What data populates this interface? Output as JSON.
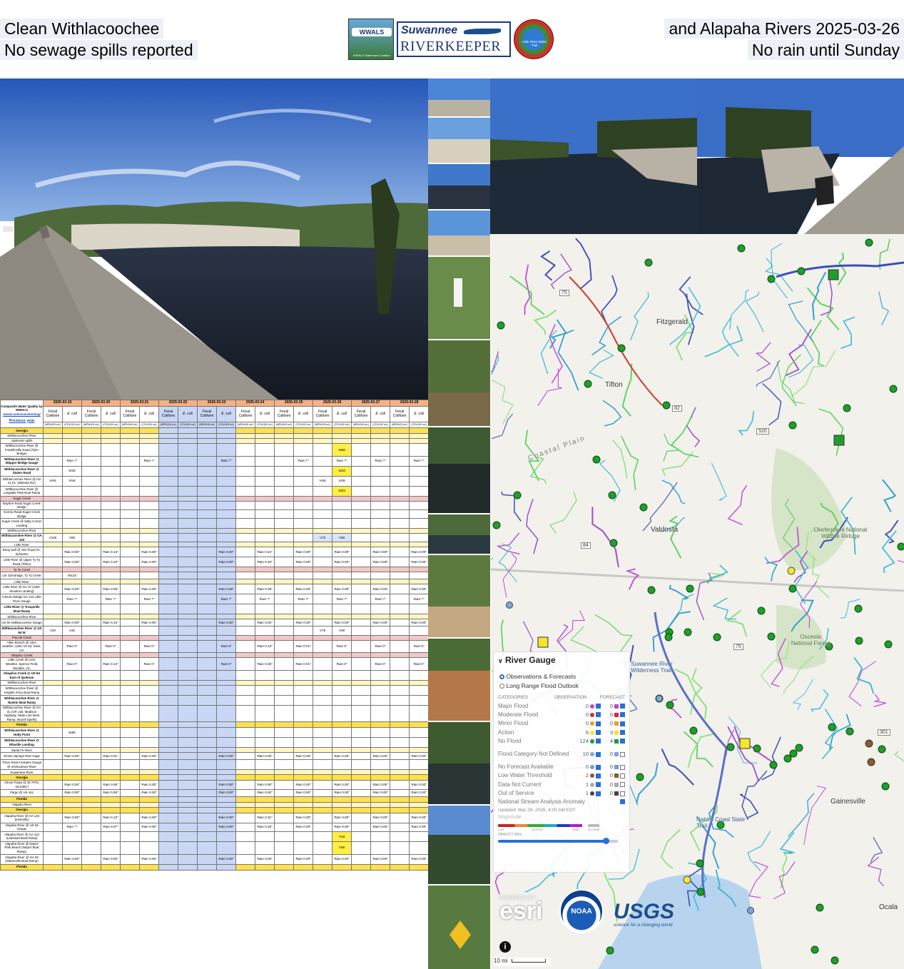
{
  "captions": {
    "top_left_1": "Clean Withlacoochee",
    "top_left_2": "No sewage spills reported",
    "top_right_1": "and Alapaha Rivers 2025-03-26",
    "top_right_2": "No rain until Sunday"
  },
  "logos": {
    "wwals": "WWALS Watershed Coalition",
    "riverkeeper_1": "Suwannee",
    "riverkeeper_2": "RIVERKEEPER",
    "little_river": "Little River Water Trail"
  },
  "table": {
    "corner": "Composite Water Quality by WWALS",
    "corner_link": "wwals.net/issues/testing/",
    "previous_year": "Previous year",
    "dates": [
      "2025-03-19",
      "2025-03-20",
      "2025-03-21",
      "2025-03-22",
      "2025-03-23",
      "2025-03-24",
      "2025-03-25",
      "2025-03-26",
      "2025-03-27",
      "2025-03-28"
    ],
    "col_fecal": "Fecal Coliform",
    "col_ecoli": "E. coli",
    "unit_fecal": "(MPN/100 mL)",
    "unit_ecoli": "(CFU/100 mL)",
    "rows": [
      {
        "t": "y",
        "label": "Georgia"
      },
      {
        "t": "s",
        "label": "Withlacoochee River"
      },
      {
        "t": "s",
        "label": "Upstream spills"
      },
      {
        "label": "Withlacoochee River @ Franklinville Road (Tyler Bridge)",
        "c": {
          "15": "W66"
        },
        "hl": [
          "15"
        ]
      },
      {
        "label": "Withlacoochee River @ Skipper Bridge Gauge",
        "c": {
          "1": "Rain ?\"",
          "5": "Rain ?\"",
          "9": "Rain ?\"",
          "13": "Rain ?\"",
          "15": "Rain ?\"",
          "17": "Rain ?\"",
          "19": "Rain ?\""
        }
      },
      {
        "label": "Withlacoochee River @ Staten Road",
        "c": {
          "1": "W33",
          "15": "W33"
        },
        "hl": [
          "15"
        ]
      },
      {
        "label": "Withlacoochee River @ US 41 (N. Valdosta Rd.)",
        "c": {
          "0": "VNS",
          "1": "VNS",
          "14": "VNS",
          "15": "VNS"
        }
      },
      {
        "label": "Withlacoochee River @ Langdale Park Boat Ramp",
        "c": {
          "15": "W33"
        },
        "hl": [
          "15"
        ]
      },
      {
        "t": "p",
        "label": "Sugar Creek"
      },
      {
        "label": "Baytree Road Sugar Creek Bridge",
        "c": {}
      },
      {
        "label": "Gornto Road Sugar Creek Bridge",
        "c": {}
      },
      {
        "label": "Sugar Creek @ Salty Corner Landing",
        "c": {}
      },
      {
        "t": "s",
        "label": "Withlacoochee River"
      },
      {
        "label": "Withlacoochee River @ GA 133",
        "c": {
          "0": "V160",
          "1": "V80",
          "14": "V70",
          "15": "V90"
        },
        "lb": [
          "14",
          "15"
        ]
      },
      {
        "t": "s",
        "label": "Little River"
      },
      {
        "label": "Deep well @ 161 Royal St., Sylvester",
        "c": {
          "1": "Rain 0.00\"",
          "3": "Rain 0.13\"",
          "5": "Rain 0.00\"",
          "9": "Rain 0.00\"",
          "11": "Rain 0.44\"",
          "13": "Rain 0.00\"",
          "15": "Rain 0.00\"",
          "17": "Rain 0.00\"",
          "19": "Rain 0.00\""
        }
      },
      {
        "label": "Little River @ Upper Ty Ty Road (Tifton)",
        "c": {
          "1": "Rain 0.00\"",
          "3": "Rain 0.10\"",
          "5": "Rain 0.00\"",
          "9": "Rain 0.00\"",
          "11": "Rain 0.33\"",
          "13": "Rain 0.00\"",
          "15": "Rain 0.00\"",
          "17": "Rain 0.00\"",
          "19": "Rain 0.00\""
        }
      },
      {
        "t": "p",
        "label": "Ty Ty Creek"
      },
      {
        "label": "US 319 Bridge, Ty Ty Creek",
        "c": {
          "1": "W133"
        }
      },
      {
        "t": "s",
        "label": "Little River"
      },
      {
        "label": "Little River @ GA 37 (Adel-Moultrie Landing)",
        "c": {
          "1": "Rain 0.00\"",
          "3": "Rain 0.08\"",
          "5": "Rain 0.00\"",
          "9": "Rain 0.00\"",
          "11": "Rain 0.28\"",
          "13": "Rain 0.00\"",
          "15": "Rain 0.00\"",
          "17": "Rain 0.00\"",
          "19": "Rain 0.00\""
        }
      },
      {
        "label": "Folsom Bridge GA 122 Little River Gauge",
        "c": {
          "1": "Rain ?\"",
          "3": "Rain ?\"",
          "5": "Rain ?\"",
          "9": "Rain ?\"",
          "11": "Rain ?\"",
          "13": "Rain ?\"",
          "15": "Rain ?\"",
          "17": "Rain ?\"",
          "19": "Rain ?\""
        }
      },
      {
        "label": "Little River @ Troupville Boat Ramp",
        "c": {}
      },
      {
        "t": "s",
        "label": "Withlacoochee River"
      },
      {
        "label": "US 84 Withlacoochee Gauge",
        "c": {
          "1": "Rain 0.00\"",
          "3": "Rain 0.10\"",
          "5": "Rain 0.00\"",
          "9": "Rain 0.00\"",
          "11": "Rain 0.02\"",
          "13": "Rain 0.00\"",
          "15": "Rain 0.00\"",
          "17": "Rain 0.00\"",
          "19": "Rain 0.00\""
        }
      },
      {
        "label": "Withlacoochee River @ US 84 W",
        "c": {
          "0": "V20",
          "1": "V40",
          "14": "V75",
          "15": "V90"
        }
      },
      {
        "t": "p",
        "label": "Piscola Creek"
      },
      {
        "label": "Allen Branch @ UGA weather, 4281 US 84, Dixie, GA",
        "c": {
          "1": "Rain 0\"",
          "3": "Rain 0\"",
          "5": "Rain 0\"",
          "9": "Rain 0\"",
          "11": "Rain 0.13\"",
          "13": "Rain 0.01\"",
          "15": "Rain 0\"",
          "17": "Rain 0\"",
          "19": "Rain 0\""
        }
      },
      {
        "t": "p",
        "label": "Okapilco Creek"
      },
      {
        "label": "Little Creek @ UGA Weather, Spence Field, Moultrie, GA",
        "c": {
          "1": "Rain 0\"",
          "3": "Rain 0.13\"",
          "5": "Rain 0\"",
          "9": "Rain 0\"",
          "11": "Rain 0.35\"",
          "13": "Rain 0.01\"",
          "15": "Rain 0\"",
          "17": "Rain 0\"",
          "19": "Rain 0\""
        }
      },
      {
        "label": "Okapilco Creek @ US 84 East of Quitman",
        "c": {}
      },
      {
        "t": "s",
        "label": "Withlacoochee River"
      },
      {
        "label": "Withlacoochee River @ Knights Ferry Boat Ramp",
        "c": {}
      },
      {
        "label": "Withlacoochee River @ Nankin Boat Ramp",
        "c": {}
      },
      {
        "label": "Withlacoochee River @ GA 31 (CR 145, Madison Highway, State Line Boat Ramp, Mozell Spells)",
        "c": {}
      },
      {
        "t": "y",
        "label": "Florida"
      },
      {
        "label": "Withlacoochee River @ Holly Point",
        "c": {
          "1": "W66"
        }
      },
      {
        "label": "Withlacoochee River @ Ellaville Landing",
        "c": {}
      },
      {
        "t": "s",
        "label": "Santa Fe River"
      },
      {
        "label": "Ginnie Springs Rain Gage",
        "c": {
          "1": "Rain 0.00\"",
          "3": "Rain 0.01\"",
          "5": "Rain 0.00\"",
          "9": "Rain 0.00\"",
          "11": "Rain 0.00\"",
          "13": "Rain 0.00\"",
          "15": "Rain 0.00\"",
          "17": "Rain 0.00\"",
          "19": "Rain 0.00\""
        }
      },
      {
        "label": "Three Rivers Estates Gauge @ Ichetucknee River",
        "c": {}
      },
      {
        "t": "s",
        "label": "Suwannee River"
      },
      {
        "t": "y",
        "label": "Georgia"
      },
      {
        "label": "Above Fargo @ 30.7075, -82.53917",
        "c": {
          "1": "Rain 0.00\"",
          "3": "Rain 0.06\"",
          "5": "Rain 0.00\"",
          "9": "Rain 0.00\"",
          "11": "Rain 0.00\"",
          "13": "Rain 0.00\"",
          "15": "Rain 0.00\"",
          "17": "Rain 0.00\"",
          "19": "Rain 0.00\""
        }
      },
      {
        "label": "Fargo @ US 441",
        "c": {
          "1": "Rain 0.00\"",
          "3": "Rain 0.08\"",
          "5": "Rain 0.00\"",
          "9": "Rain 0.00\"",
          "11": "Rain 0.00\"",
          "13": "Rain 0.00\"",
          "15": "Rain 0.00\"",
          "17": "Rain 0.00\"",
          "19": "Rain 0.00\""
        }
      },
      {
        "t": "y",
        "label": "Florida"
      },
      {
        "t": "s",
        "label": "Alapaha River"
      },
      {
        "t": "y",
        "label": "Georgia"
      },
      {
        "label": "Alapaha River @ GA 125 (Irwinville)",
        "c": {
          "1": "Rain 0.00\"",
          "3": "Rain 0.13\"",
          "5": "Rain 0.00\"",
          "9": "Rain 0.00\"",
          "11": "Rain 0.31\"",
          "13": "Rain 0.00\"",
          "15": "Rain 0.00\"",
          "17": "Rain 0.00\"",
          "19": "Rain 0.00\""
        }
      },
      {
        "label": "Alapaha River @ US 82 Gauge",
        "c": {
          "1": "Rain ?\"",
          "3": "Rain 0.07\"",
          "5": "Rain 0.00\"",
          "9": "Rain 0.00\"",
          "11": "Rain 0.25\"",
          "13": "Rain 0.00\"",
          "15": "Rain 0.00\"",
          "17": "Rain 0.00\"",
          "19": "Rain 0.00\""
        }
      },
      {
        "label": "Alapaha River @ GA 122 (Lakeland Boat Ramp)",
        "c": {
          "15": "V33"
        },
        "hl": [
          "15"
        ]
      },
      {
        "label": "Alapaha River @ Naylor Park Beach (Naylor Boat Ramp)",
        "c": {
          "15": "V66"
        },
        "hl": [
          "15"
        ]
      },
      {
        "label": "Alapaha River @ GA 94 (Statenville Boat Ramp)",
        "c": {
          "1": "Rain 0.00\"",
          "3": "Rain 0.05\"",
          "5": "Rain 0.00\"",
          "9": "Rain 0.00\"",
          "11": "Rain 0.00\"",
          "13": "Rain 0.00\"",
          "15": "Rain 0.00\"",
          "17": "Rain 0.00\"",
          "19": "Rain 0.00\""
        }
      },
      {
        "t": "y",
        "label": "Florida"
      }
    ]
  },
  "map": {
    "places": {
      "fitzgerald": "Fitzgerald",
      "tifton": "Tifton",
      "valdosta": "Valdosta",
      "okefenokee": "Okefenokee National Wildlife Refuge",
      "osceola": "Osceola National Forest",
      "suwannee_trail": "Suwannee River Wilderness Trail",
      "nature_coast": "Nature Coast State Trail",
      "gainesville": "Gainesville",
      "ocala": "Ocala",
      "coastal_plain": "Coastal Plain"
    },
    "routes": [
      "75",
      "82",
      "520",
      "84",
      "75",
      "301"
    ],
    "scale": "10 mi",
    "legend": {
      "title": "River Gauge",
      "opt1": "Observations & Forecasts",
      "opt2": "Long Range Flood Outlook",
      "h_categories": "CATEGORIES",
      "h_observation": "OBSERVATION",
      "h_forecast": "FORECAST",
      "rows": [
        {
          "name": "Major Flood",
          "obs": "0",
          "fc": "0",
          "color": "#b74cc9"
        },
        {
          "name": "Moderate Flood",
          "obs": "0",
          "fc": "0",
          "color": "#d6293a"
        },
        {
          "name": "Minor Flood",
          "obs": "0",
          "fc": "0",
          "color": "#f29a2e"
        },
        {
          "name": "Action",
          "obs": "6",
          "fc": "3",
          "color": "#f5e62a"
        },
        {
          "name": "No Flood",
          "obs": "124",
          "fc": "4",
          "color": "#1f9e2b"
        },
        {
          "name": "Flood Category Not Defined",
          "obs": "10",
          "fc": "0",
          "color": "#7fa7d8"
        },
        {
          "name": "No Forecast Available",
          "obs": "0",
          "fc": "0",
          "color": "#6f9fd8"
        },
        {
          "name": "Low Water Threshold",
          "obs": "2",
          "fc": "0",
          "color": "#8b5a2b"
        },
        {
          "name": "Data Not Current",
          "obs": "1",
          "fc": "0",
          "color": "#aaaaaa"
        },
        {
          "name": "Out of Service",
          "obs": "1",
          "fc": "0",
          "color": "#444444"
        }
      ],
      "anomaly": "National Stream Analysis Anomaly",
      "updated": "Updated: Mar 29, 2025, 4:00 AM EDT",
      "magnitude": "Magnitude",
      "scale_low": "Low",
      "scale_normal": "Normal",
      "scale_high": "High",
      "scale_nodata": "No Data",
      "opacity": "OPACITY 90%",
      "opacity_value": 0.9
    },
    "logos": {
      "esri": "esri",
      "powered": "POWERED BY",
      "noaa": "NOAA",
      "usgs": "USGS",
      "usgs_tag": "science for a changing world"
    }
  }
}
